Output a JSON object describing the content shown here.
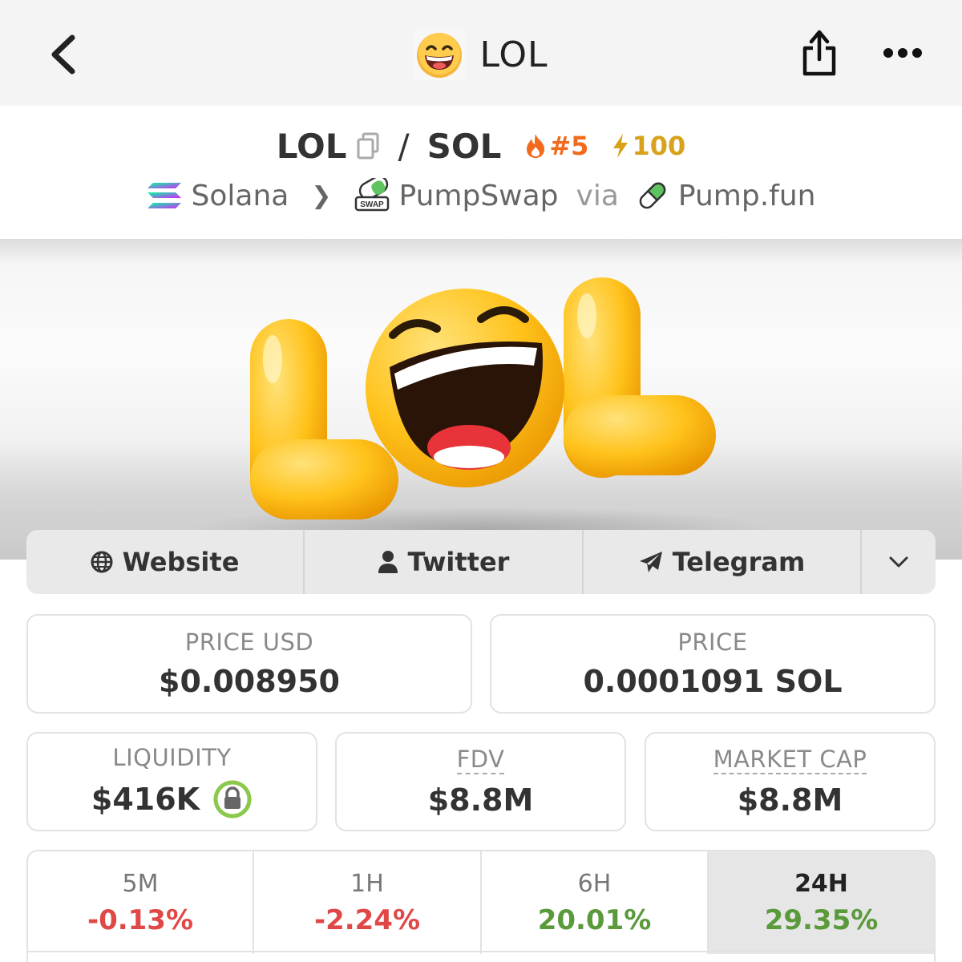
{
  "header": {
    "title": "LOL",
    "back_icon": "chevron-left-icon",
    "share_icon": "share-icon",
    "more_icon": "more-horizontal-icon"
  },
  "pair": {
    "base": "LOL",
    "separator": "/",
    "quote": "SOL",
    "rank": "#5",
    "boost": "100",
    "colors": {
      "rank": "#f26b1d",
      "boost": "#d8a21a"
    }
  },
  "route": {
    "chain": "Solana",
    "dex": "PumpSwap",
    "via_label": "via",
    "launchpad": "Pump.fun"
  },
  "banner": {
    "alt": "LOL"
  },
  "socials": {
    "website": "Website",
    "twitter": "Twitter",
    "telegram": "Telegram"
  },
  "stats": {
    "price_usd": {
      "label": "PRICE USD",
      "value": "$0.008950"
    },
    "price": {
      "label": "PRICE",
      "value": "0.0001091 SOL"
    },
    "liquidity": {
      "label": "LIQUIDITY",
      "value": "$416K"
    },
    "fdv": {
      "label": "FDV",
      "value": "$8.8M"
    },
    "market_cap": {
      "label": "MARKET CAP",
      "value": "$8.8M"
    }
  },
  "timeframes": [
    {
      "label": "5M",
      "change": "-0.13%"
    },
    {
      "label": "1H",
      "change": "-2.24%"
    },
    {
      "label": "6H",
      "change": "20.01%"
    },
    {
      "label": "24H",
      "change": "29.35%"
    }
  ],
  "colors": {
    "negative": "#e04848",
    "positive": "#5a9a3a",
    "selected_tab_bg": "#e6e6e6"
  }
}
